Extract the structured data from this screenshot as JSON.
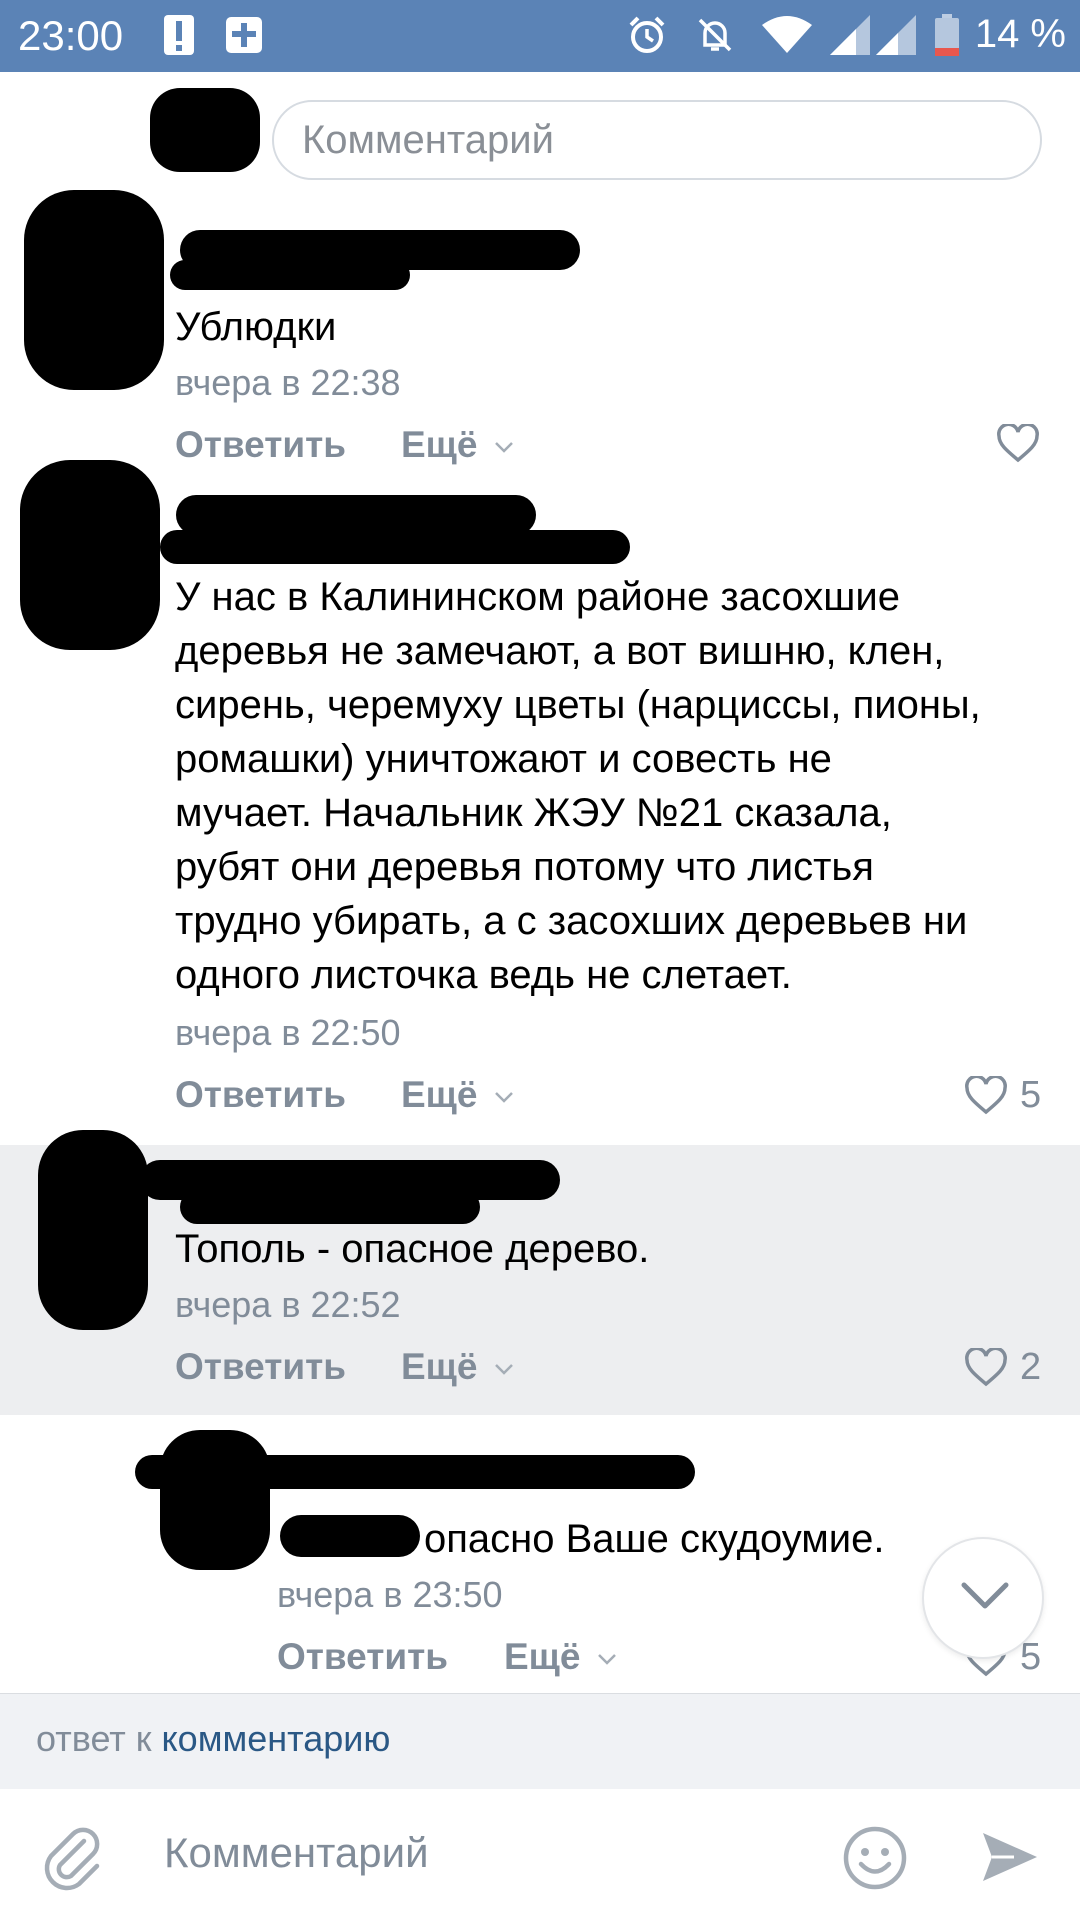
{
  "status_bar": {
    "time": "23:00",
    "battery": "14 %",
    "icons": [
      "alert-icon",
      "plus-box-icon",
      "alarm-icon",
      "notifications-off-icon",
      "wifi-icon",
      "signal-icon",
      "signal-icon",
      "battery-icon"
    ]
  },
  "composer_top": {
    "placeholder": "Комментарий"
  },
  "comments": [
    {
      "text": "Ублюдки",
      "time": "вчера в 22:38",
      "reply": "Ответить",
      "more": "Ещё",
      "likes": ""
    },
    {
      "lines": [
        "У нас в Калининском районе засохшие",
        "деревья не замечают, а вот вишню, клен,",
        "сирень, черемуху цветы (нарциссы, пионы,",
        "ромашки) уничтожают и совесть не",
        "мучает. Начальник ЖЭУ №21 сказала,",
        "рубят они деревья потому что листья",
        "трудно убирать, а с засохших деревьев ни",
        "одного листочка ведь не слетает."
      ],
      "time": "вчера в 22:50",
      "reply": "Ответить",
      "more": "Ещё",
      "likes": "5"
    },
    {
      "text": "Тополь - опасное дерево.",
      "time": "вчера в 22:52",
      "reply": "Ответить",
      "more": "Ещё",
      "likes": "2"
    },
    {
      "text": "опасно Ваше скудоумие.",
      "time": "вчера в 23:50",
      "reply": "Ответить",
      "more": "Ещё",
      "likes": "5"
    }
  ],
  "reply_bar": {
    "prefix": "ответ к",
    "link": "комментарию"
  },
  "composer_bottom": {
    "placeholder": "Комментарий"
  },
  "colors": {
    "status_bar": "#5b83b6",
    "link": "#2a5885",
    "meta": "#818c99",
    "highlight": "#edeef0"
  }
}
